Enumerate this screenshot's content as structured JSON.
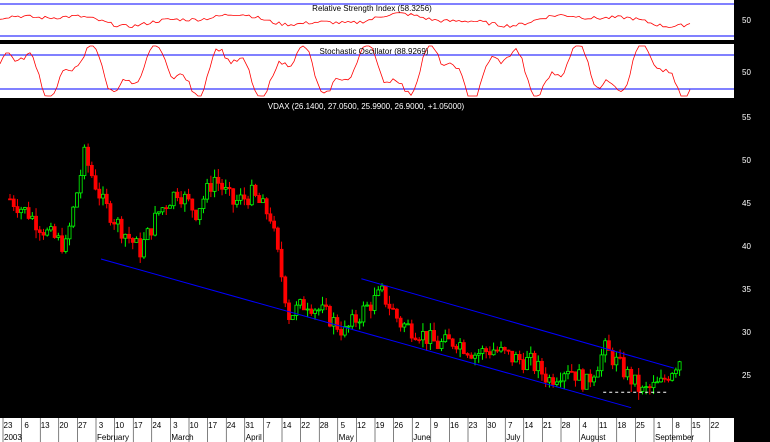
{
  "colors": {
    "background": "#000000",
    "panel_bg": "#ffffff",
    "channel": "#0000ff",
    "rsi_line": "#ff0000",
    "bull_candle": "#00ff00",
    "bear_candle": "#ff0000",
    "text": "#ffffff",
    "support": "#ffffff"
  },
  "chart_data": [
    {
      "type": "line",
      "panel": "rsi",
      "title": "Relative Strength Index (58.3256)",
      "y_ticks": [
        "50"
      ],
      "value": 58.3256,
      "bands": [
        30,
        70
      ]
    },
    {
      "type": "line",
      "panel": "stochastic",
      "title": "Stochastic Oscillator (88.9269)",
      "y_ticks": [
        "50"
      ],
      "value": 88.9269,
      "bands": [
        20,
        80
      ]
    },
    {
      "type": "candlestick",
      "panel": "price",
      "title": "VDAX (26.1400, 27.0500, 25.9900, 26.9000, +1.05000)",
      "last_bar": {
        "open": 26.14,
        "high": 27.05,
        "low": 25.99,
        "close": 26.9,
        "change": 1.05
      },
      "ylim": [
        20,
        57
      ],
      "y_ticks": [
        "55",
        "50",
        "45",
        "40",
        "35",
        "30",
        "25"
      ],
      "x_ticks": [
        "23",
        "6",
        "13",
        "20",
        "27",
        "3",
        "10",
        "17",
        "24",
        "3",
        "10",
        "17",
        "24",
        "31",
        "7",
        "14",
        "22",
        "28",
        "5",
        "12",
        "19",
        "26",
        "2",
        "9",
        "16",
        "23",
        "30",
        "7",
        "14",
        "21",
        "28",
        "4",
        "11",
        "18",
        "25",
        "1",
        "8",
        "15",
        "22"
      ],
      "months": [
        {
          "label": "2003",
          "tick": 0
        },
        {
          "label": "February",
          "tick": 5
        },
        {
          "label": "March",
          "tick": 9
        },
        {
          "label": "April",
          "tick": 13
        },
        {
          "label": "May",
          "tick": 18
        },
        {
          "label": "June",
          "tick": 22
        },
        {
          "label": "July",
          "tick": 27
        },
        {
          "label": "August",
          "tick": 31
        },
        {
          "label": "September",
          "tick": 35
        }
      ],
      "channel_lower": {
        "from": {
          "tick": 5,
          "value": 38.5
        },
        "to": {
          "tick": 33.5,
          "value": 21.2
        }
      },
      "channel_upper": {
        "from": {
          "tick": 19,
          "value": 36.2
        },
        "to": {
          "tick": 35.8,
          "value": 25.8
        }
      },
      "support": {
        "from": {
          "tick": 32,
          "value": 23.0
        },
        "to": {
          "tick": 35.5,
          "value": 23.0
        }
      },
      "closes_weekly": [
        45.5,
        43.8,
        41.5,
        40.0,
        50.5,
        45.0,
        42.0,
        39.5,
        44.0,
        46.5,
        44.0,
        48.0,
        45.0,
        46.0,
        43.5,
        32.0,
        33.5,
        32.0,
        30.0,
        32.5,
        34.5,
        31.0,
        30.0,
        28.5,
        29.0,
        27.5,
        28.0,
        27.0,
        26.5,
        24.5,
        26.0,
        24.0,
        28.0,
        25.5,
        23.0,
        24.0,
        26.9
      ]
    }
  ]
}
